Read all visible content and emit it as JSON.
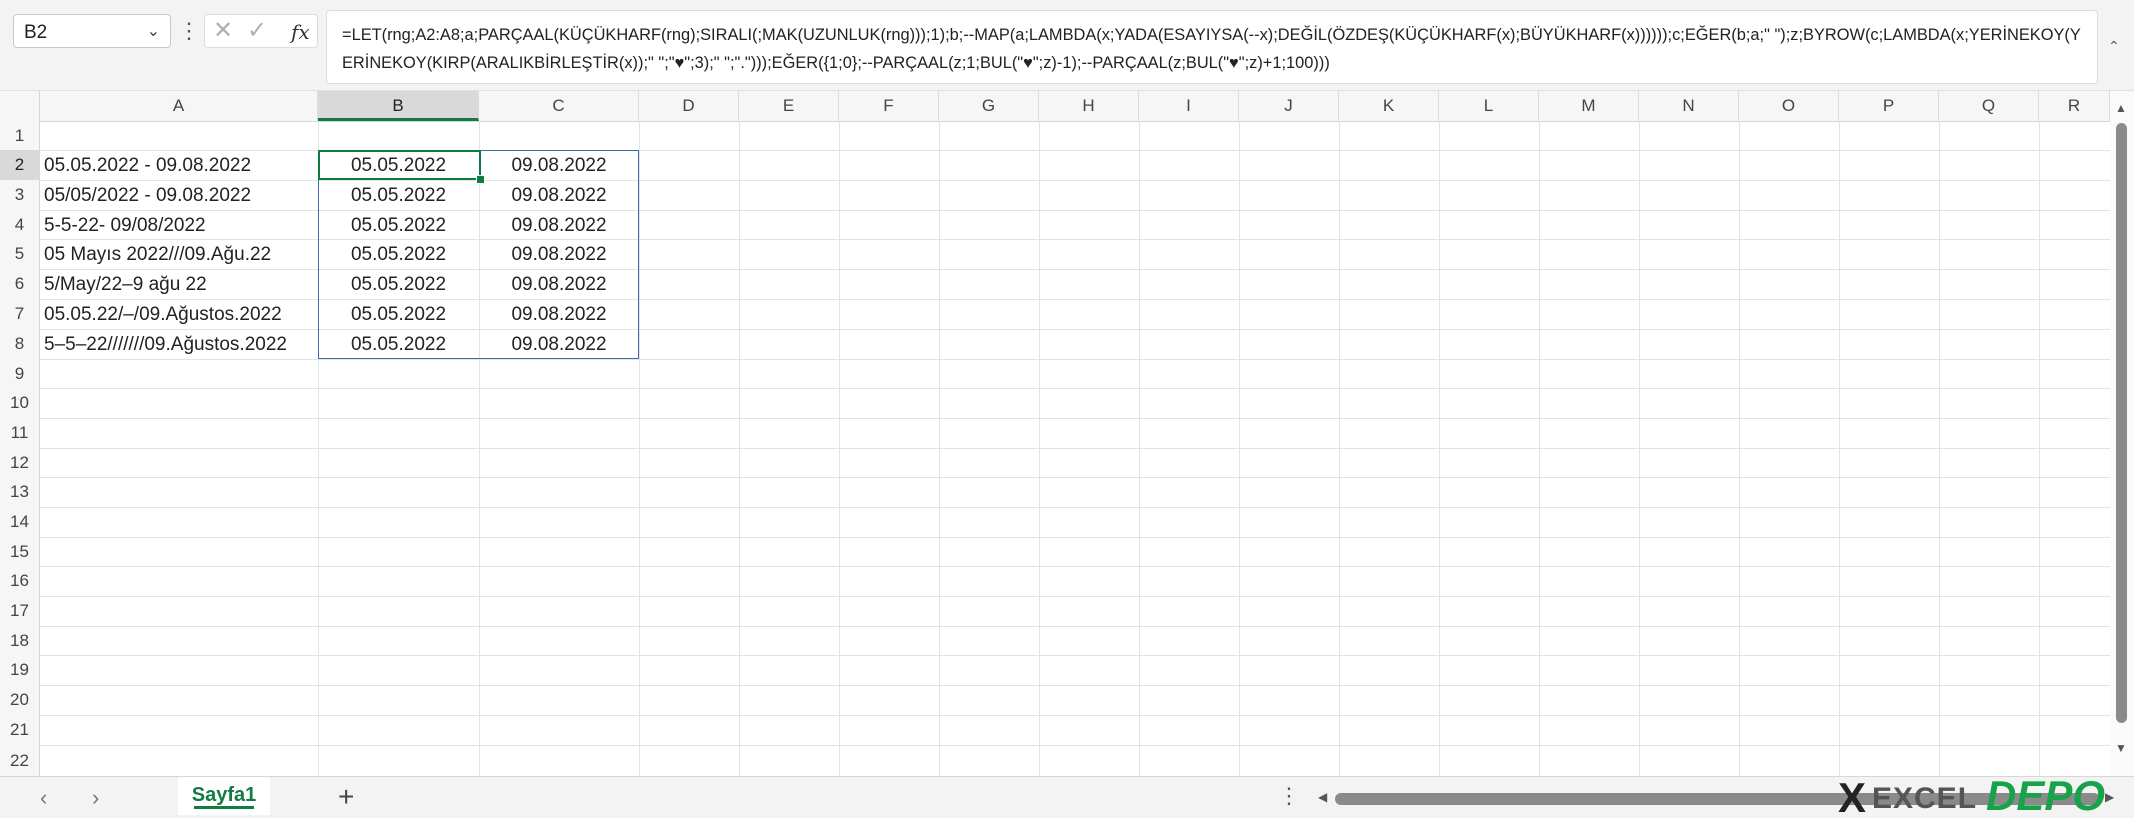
{
  "namebox": {
    "value": "B2"
  },
  "formula": {
    "text": "=LET(rng;A2:A8;a;PARÇAAL(KÜÇÜKHARF(rng);SIRALI(;MAK(UZUNLUK(rng)));1);b;--MAP(a;LAMBDA(x;YADA(ESAYIYSA(--x);DEĞİL(ÖZDEŞ(KÜÇÜKHARF(x);BÜYÜKHARF(x))))));c;EĞER(b;a;\" \");z;BYROW(c;LAMBDA(x;YERİNEKOY(YERİNEKOY(KIRP(ARALIKBİRLEŞTİR(x));\" \";\"♥\";3);\" \";\".\")));EĞER({1;0};--PARÇAAL(z;1;BUL(\"♥\";z)-1);--PARÇAAL(z;BUL(\"♥\";z)+1;100)))"
  },
  "columns": [
    "A",
    "B",
    "C",
    "D",
    "E",
    "F",
    "G",
    "H",
    "I",
    "J",
    "K",
    "L",
    "M",
    "N",
    "O",
    "P",
    "Q",
    "R"
  ],
  "rows": [
    "1",
    "2",
    "3",
    "4",
    "5",
    "6",
    "7",
    "8",
    "9",
    "10",
    "11",
    "12",
    "13",
    "14",
    "15",
    "16",
    "17",
    "18",
    "19",
    "20",
    "21",
    "22"
  ],
  "cells": {
    "A": [
      "",
      "05.05.2022 - 09.08.2022",
      "05/05/2022 - 09.08.2022",
      "5-5-22- 09/08/2022",
      "05 Mayıs 2022///09.Ağu.22",
      "5/May/22–9 ağu 22",
      "05.05.22/–/09.Ağustos.2022",
      "5–5–22///////09.Ağustos.2022"
    ],
    "B": [
      "",
      "05.05.2022",
      "05.05.2022",
      "05.05.2022",
      "05.05.2022",
      "05.05.2022",
      "05.05.2022",
      "05.05.2022"
    ],
    "C": [
      "",
      "09.08.2022",
      "09.08.2022",
      "09.08.2022",
      "09.08.2022",
      "09.08.2022",
      "09.08.2022",
      "09.08.2022"
    ]
  },
  "sheet_tabs": [
    {
      "label": "Sayfa1",
      "active": true
    }
  ],
  "add_sheet_label": "+",
  "watermark": {
    "x": "X",
    "excel": "EXCEL",
    "depo": "DEPO"
  },
  "colors": {
    "excel_green": "#107c41",
    "selection_border": "#3b6ea8",
    "header_bg": "#f6f6f6"
  },
  "icons": {
    "namebox_dropdown": "chevron-down-icon",
    "cancel": "close-icon",
    "enter": "check-icon",
    "insert_function": "fx-icon",
    "sheet_prev": "chevron-left-icon",
    "sheet_next": "chevron-right-icon",
    "add_sheet": "plus-icon"
  }
}
